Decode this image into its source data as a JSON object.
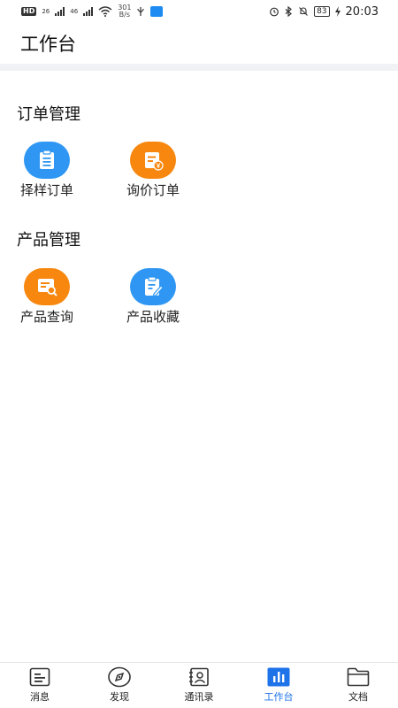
{
  "status_bar": {
    "hd": "HD",
    "net1": "26",
    "net2": "46",
    "speed_value": "301",
    "speed_unit": "B/s",
    "battery": "83",
    "time": "20:03"
  },
  "header": {
    "title": "工作台"
  },
  "sections": [
    {
      "title": "订单管理",
      "items": [
        {
          "label": "择样订单",
          "icon": "clipboard-list-icon",
          "color": "#2f97f3"
        },
        {
          "label": "询价订单",
          "icon": "price-document-icon",
          "color": "#f7870f"
        }
      ]
    },
    {
      "title": "产品管理",
      "items": [
        {
          "label": "产品查询",
          "icon": "document-search-icon",
          "color": "#f7870f"
        },
        {
          "label": "产品收藏",
          "icon": "clipboard-edit-icon",
          "color": "#2f97f3"
        }
      ]
    }
  ],
  "tabbar": {
    "active_color": "#1e73e8",
    "tabs": [
      {
        "label": "消息",
        "icon": "message-list-icon"
      },
      {
        "label": "发现",
        "icon": "compass-icon"
      },
      {
        "label": "通讯录",
        "icon": "contacts-book-icon"
      },
      {
        "label": "工作台",
        "icon": "workbench-chart-icon",
        "active": true
      },
      {
        "label": "文档",
        "icon": "folder-icon"
      }
    ]
  }
}
